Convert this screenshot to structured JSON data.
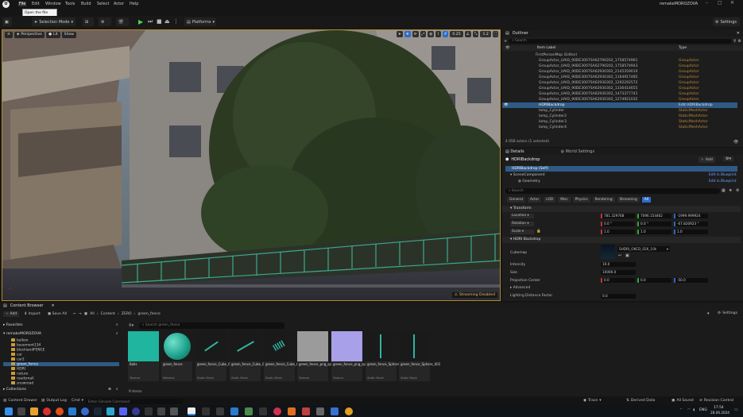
{
  "app": {
    "project_name": "remakeMOROZOVA",
    "menu": [
      "File",
      "Edit",
      "Window",
      "Tools",
      "Build",
      "Select",
      "Actor",
      "Help"
    ],
    "tooltip": "Open the file menu",
    "settings_label": "Settings"
  },
  "toolbar": {
    "selection_mode": "Selection Mode",
    "platforms": "Platforms"
  },
  "viewport": {
    "view_mode": "Perspective",
    "lit_mode": "Lit",
    "show_label": "Show",
    "grid_value": "0.25",
    "camera_speed": "1.2",
    "streaming_status": "Streaming Disabled"
  },
  "outliner": {
    "tab_label": "Outliner",
    "search_placeholder": "Search",
    "columns": {
      "label": "Item Label",
      "type": "Type"
    },
    "map": "FirstPersonMap (Editor)",
    "rows": [
      {
        "label": "GroupActor_UAID_90DE3007SA62790202_1758574961",
        "type": "GroupActor"
      },
      {
        "label": "GroupActor_UAID_90DE3007SA62790202_1758574943",
        "type": "GroupActor"
      },
      {
        "label": "GroupActor_UAID_90DE3007SA62930302_2145359010",
        "type": "GroupActor"
      },
      {
        "label": "GroupActor_UAID_90DE3007SA62930302_1164917485",
        "type": "GroupActor"
      },
      {
        "label": "GroupActor_UAID_90DE3007SA62930302_1292292572",
        "type": "GroupActor"
      },
      {
        "label": "GroupActor_UAID_90DE3007SA62930302_1336414655",
        "type": "GroupActor"
      },
      {
        "label": "GroupActor_UAID_90DE3007SA62930302_1473377741",
        "type": "GroupActor"
      },
      {
        "label": "GroupActor_UAID_90DE3007SA62930302_1274921032",
        "type": "GroupActor"
      },
      {
        "label": "HDRIBackdrop",
        "type": "Edit HDRIBackdrop"
      },
      {
        "label": "lamp_Cylinder",
        "type": "StaticMeshActor"
      },
      {
        "label": "lamp_Cylinder2",
        "type": "StaticMeshActor"
      },
      {
        "label": "lamp_Cylinder3",
        "type": "StaticMeshActor"
      },
      {
        "label": "lamp_Cylinder4",
        "type": "StaticMeshActor"
      }
    ],
    "actor_count": "4 058 actors (1 selected)"
  },
  "details": {
    "tab_label": "Details",
    "world_settings_tab": "World Settings",
    "actor_name": "HDRIBackdrop",
    "add_label": "Add",
    "component_self": "HDRIBackdrop (Self)",
    "scene_component": "SceneComponent",
    "geometry": "Geometry",
    "edit_in_blueprint": "Edit in Blueprint",
    "search_placeholder": "Search",
    "filter_tabs": [
      "General",
      "Actor",
      "LOD",
      "Misc",
      "Physics",
      "Rendering",
      "Streaming",
      "All"
    ],
    "transform_label": "Transform",
    "location_label": "Location",
    "location": [
      "781.329768",
      "7096.154462",
      "-1999.999924"
    ],
    "rotation_label": "Rotation",
    "rotation": [
      "0.0 °",
      "0.0 °",
      "-67.820923 °"
    ],
    "scale_label": "Scale",
    "scale": [
      "1.0",
      "1.0",
      "1.0"
    ],
    "hdri_section": "HDRI Backdrop",
    "cubemap_label": "Cubemap",
    "cubemap_value": "SHDRI_OKCD_026_10k",
    "intensity_label": "Intensity",
    "intensity": "10.0",
    "size_label": "Size",
    "size": "10000.0",
    "projection_center_label": "Projection Center",
    "projection_center": [
      "0.0",
      "0.0",
      "-50.0"
    ],
    "advanced_label": "Advanced",
    "lighting_distance_label": "Lighting Distance Factor",
    "lighting_distance": "0.0"
  },
  "content_browser": {
    "tab_label": "Content Browser",
    "add_label": "Add",
    "import_label": "Import",
    "save_all_label": "Save All",
    "breadcrumb": [
      "All",
      "Content",
      "ZERO",
      "green_fence"
    ],
    "settings_label": "Settings",
    "favorites_label": "Favorites",
    "project_root": "remakeMOROZOVA",
    "folders": [
      "balkon",
      "basement134",
      "blocklandFENCE",
      "car",
      "car2",
      "green_fence",
      "HDRI",
      "nature",
      "roadsmall",
      "snowroad"
    ],
    "collections_label": "Collections",
    "search_placeholder": "Search green_fence",
    "items_count": "9 items",
    "assets": [
      {
        "name": "Balls",
        "type": "Texture",
        "color": "#1fb59e"
      },
      {
        "name": "green_fence",
        "type": "Material",
        "color": "#22b3a0"
      },
      {
        "name": "green_fence_Cube_009",
        "type": "Static Mesh",
        "color": "#1a1a1a"
      },
      {
        "name": "green_fence_Cube_012",
        "type": "Static Mesh",
        "color": "#1a1a1a"
      },
      {
        "name": "green_fence_Cube_013",
        "type": "Static Mesh",
        "color": "#1a1a1a"
      },
      {
        "name": "green_fence_png_specular_1_...",
        "type": "Texture",
        "color": "#9b9b9b"
      },
      {
        "name": "green_fence_png_specular_4_...",
        "type": "Texture",
        "color": "#a8a0e8"
      },
      {
        "name": "green_fence_Sphere",
        "type": "Static Mesh",
        "color": "#1a1a1a"
      },
      {
        "name": "green_fence_Sphere_001",
        "type": "Static Mesh",
        "color": "#1a1a1a"
      }
    ]
  },
  "statusbar": {
    "content_drawer": "Content Drawer",
    "output_log": "Output Log",
    "cmd": "Cmd",
    "console_placeholder": "Enter Console Command",
    "trace": "Trace",
    "derived_data": "Derived Data",
    "all_saved": "All Saved",
    "revision_control": "Revision Control"
  },
  "taskbar": {
    "language": "ENG",
    "time": "17:54",
    "date": "28.06.2024"
  }
}
